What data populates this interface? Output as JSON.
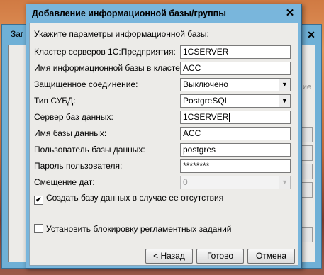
{
  "background_window": {
    "title": "Заг",
    "side_text": "ие"
  },
  "dialog": {
    "title": "Добавление информационной базы/группы",
    "prompt": "Укажите параметры информационной базы:",
    "close_icon": "close-icon",
    "fields": [
      {
        "label": "Кластер серверов 1С:Предприятия:",
        "value": "1CSERVER"
      },
      {
        "label": "Имя информационной базы в кластере:",
        "value": "ACC"
      },
      {
        "label": "Защищенное соединение:",
        "value": "Выключено"
      },
      {
        "label": "Тип СУБД:",
        "value": "PostgreSQL"
      },
      {
        "label": "Сервер баз данных:",
        "value": "1CSERVER"
      },
      {
        "label": "Имя базы данных:",
        "value": "ACC"
      },
      {
        "label": "Пользователь базы данных:",
        "value": "postgres"
      },
      {
        "label": "Пароль пользователя:",
        "value": "********"
      },
      {
        "label": "Смещение дат:",
        "value": "0"
      }
    ],
    "create_db_checkbox": {
      "label": "Создать базу данных в случае ее отсутствия",
      "checked": true,
      "mark": "✔"
    },
    "block_jobs_checkbox": {
      "label": "Установить блокировку регламентных заданий",
      "checked": false
    },
    "buttons": {
      "back": "< Назад",
      "ok": "Готово",
      "cancel": "Отмена"
    }
  }
}
